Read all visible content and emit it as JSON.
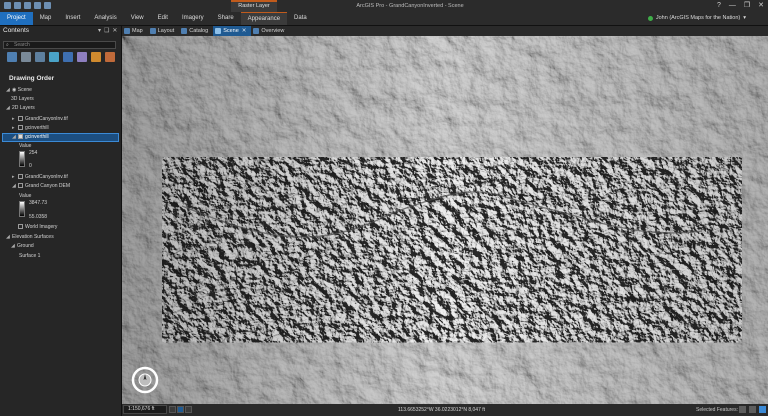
{
  "app": {
    "title": "ArcGIS Pro - GrandCanyonInverted - Scene",
    "contextual_tab": "Raster Layer",
    "window_buttons": [
      "?",
      "—",
      "❐",
      "✕"
    ]
  },
  "ribbon": {
    "tabs": [
      "Project",
      "Map",
      "Insert",
      "Analysis",
      "View",
      "Edit",
      "Imagery",
      "Share",
      "Appearance",
      "Data"
    ],
    "active_tab": "Appearance",
    "user": "John (ArcGIS Maps for the Nation)"
  },
  "contents": {
    "title": "Contents",
    "controls": [
      "▾",
      "❑",
      "✕"
    ],
    "search_placeholder": "Search",
    "drawing_order": "Drawing Order",
    "tree": {
      "scene": "Scene",
      "layers_3d": "3D Layers",
      "layers_2d": "2D Layers",
      "layer1": "GrandCanyonInv.tif",
      "layer2": "gcinverthill",
      "layer3": "gcinverthill",
      "value_label": "Value",
      "ramp1_high": "254",
      "ramp1_low": "0",
      "layer4": "GrandCanyonInv.tif",
      "layer5": "Grand Canyon DEM",
      "value_label2": "Value",
      "ramp2_high": "3847.73",
      "ramp2_low": "55.0358",
      "world_imagery": "World Imagery",
      "elevation_surfaces": "Elevation Surfaces",
      "ground": "Ground",
      "surface1": "Surface 1"
    }
  },
  "view_tabs": [
    {
      "label": "Map",
      "active": false
    },
    {
      "label": "Layout",
      "active": false
    },
    {
      "label": "Catalog",
      "active": false
    },
    {
      "label": "Scene",
      "active": true
    },
    {
      "label": "Overview",
      "active": false
    }
  ],
  "status": {
    "scale": "1:150,676 ft",
    "coordinates": "113.6653252°W 36.0223012°N  8,047 ft",
    "selected_features": "Selected Features: 0"
  },
  "colors": {
    "project_tab": "#1f6fbf",
    "accent_orange": "#c15b1c",
    "selection": "#1c4e80",
    "user_status": "#3fae49"
  },
  "icons": [
    "list-by-drawing-order-icon",
    "list-by-source-icon",
    "list-by-selection-icon",
    "list-by-editing-icon",
    "list-by-snapping-icon",
    "list-by-labeling-icon",
    "list-by-perspective-icon",
    "charts-icon"
  ]
}
